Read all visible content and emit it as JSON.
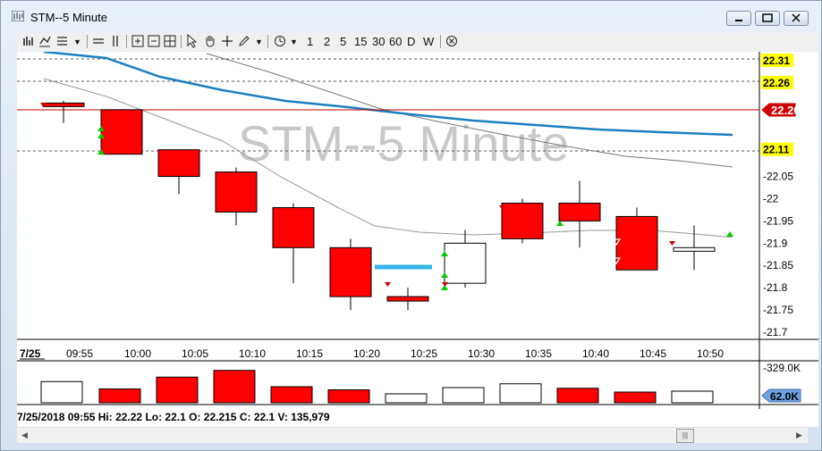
{
  "window": {
    "title": "STM--5 Minute"
  },
  "toolbar": {
    "intervals": [
      "1",
      "2",
      "5",
      "15",
      "30",
      "60",
      "D",
      "W"
    ]
  },
  "chart": {
    "watermark": "STM--5 Minute",
    "date_tab": "7/25",
    "price_labels": [
      "22.31",
      "22.26",
      "22.11",
      "22.05",
      "22",
      "21.95",
      "21.9",
      "21.85",
      "21.8",
      "21.75",
      "21.7"
    ],
    "last_price": "22.20",
    "volume_axis_label": "-329.0K",
    "volume_marker": "62.0K",
    "colors": {
      "down": "#ff0000",
      "up": "#ffffff",
      "ma_blue": "#1a80c0",
      "ma_gray": "#888888",
      "price_line": "#cc0000",
      "tag_yellow": "#ffff00"
    }
  },
  "chart_data": {
    "type": "candlestick",
    "x": [
      "09:55",
      "10:00",
      "10:05",
      "10:10",
      "10:15",
      "10:20",
      "10:25",
      "10:30",
      "10:35",
      "10:40",
      "10:45",
      "10:50"
    ],
    "open": [
      22.215,
      22.2,
      22.11,
      22.06,
      21.98,
      21.89,
      21.78,
      21.81,
      21.99,
      21.99,
      21.96,
      21.89
    ],
    "high": [
      22.22,
      22.2,
      22.11,
      22.07,
      21.99,
      21.91,
      21.8,
      21.93,
      22.0,
      22.04,
      21.98,
      21.94
    ],
    "low": [
      22.17,
      22.1,
      22.01,
      21.94,
      21.81,
      21.75,
      21.75,
      21.8,
      21.9,
      21.89,
      21.84,
      21.84
    ],
    "close": [
      22.21,
      22.1,
      22.05,
      21.97,
      21.89,
      21.78,
      21.77,
      21.9,
      21.91,
      21.95,
      21.84,
      21.89
    ],
    "volume_bars": [
      {
        "color": "up"
      },
      {
        "color": "down"
      },
      {
        "color": "down"
      },
      {
        "color": "down"
      },
      {
        "color": "down"
      },
      {
        "color": "down"
      },
      {
        "color": "up"
      },
      {
        "color": "up"
      },
      {
        "color": "up"
      },
      {
        "color": "down"
      },
      {
        "color": "down"
      },
      {
        "color": "up"
      }
    ],
    "volume": [
      95000,
      62000,
      115000,
      145000,
      72000,
      58000,
      40000,
      68000,
      85000,
      65000,
      48000,
      52000
    ],
    "ylim": [
      21.7,
      22.33
    ]
  },
  "status": {
    "text": "7/25/2018 09:55   Hi: 22.22   Lo: 22.1   O: 22.215   C: 22.1   V: 135,979"
  }
}
